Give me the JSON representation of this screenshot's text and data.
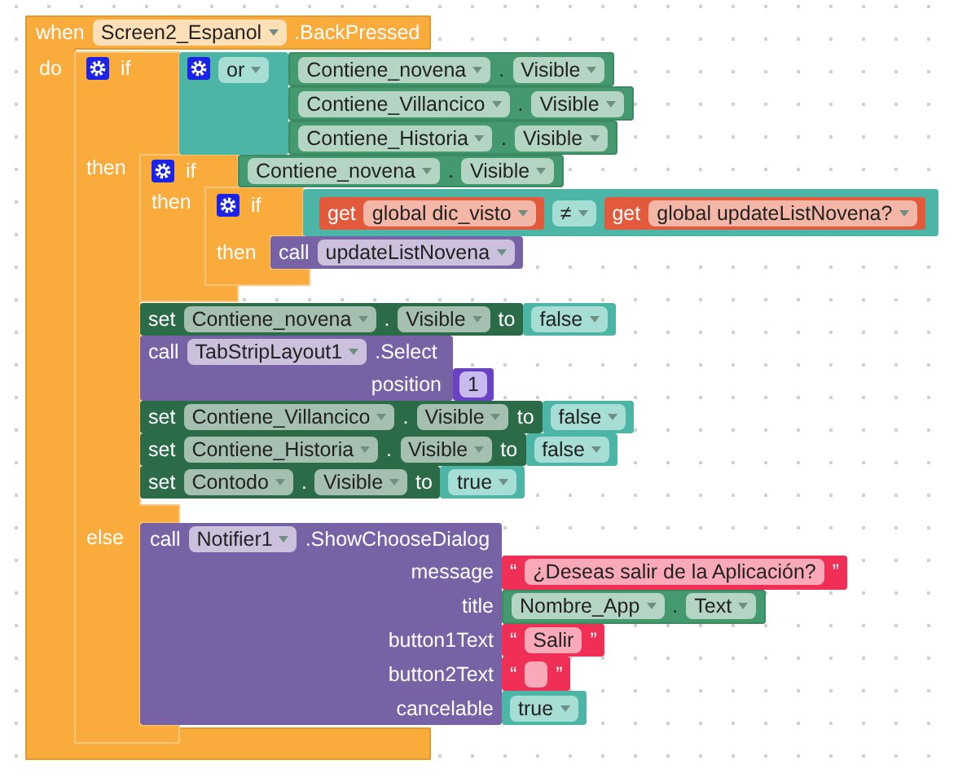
{
  "event": {
    "keyword": "when",
    "component": "Screen2_Espanol",
    "event": ".BackPressed",
    "do_label": "do"
  },
  "if_else": {
    "if_label": "if",
    "then_label": "then",
    "else_label": "else",
    "condition": {
      "operator": "or",
      "operands": [
        {
          "component": "Contiene_novena",
          "dot": ".",
          "property": "Visible"
        },
        {
          "component": "Contiene_Villancico",
          "dot": ".",
          "property": "Visible"
        },
        {
          "component": "Contiene_Historia",
          "dot": ".",
          "property": "Visible"
        }
      ]
    }
  },
  "then_if": {
    "if_label": "if",
    "then_label": "then",
    "condition": {
      "component": "Contiene_novena",
      "dot": ".",
      "property": "Visible"
    },
    "inner_if": {
      "if_label": "if",
      "then_label": "then",
      "compare": {
        "left": {
          "keyword": "get",
          "variable": "global dic_visto"
        },
        "operator": "≠",
        "right": {
          "keyword": "get",
          "variable": "global updateListNovena?"
        }
      },
      "call": {
        "keyword": "call",
        "procedure": "updateListNovena"
      }
    }
  },
  "then_statements": [
    {
      "kind": "set",
      "keyword": "set",
      "component": "Contiene_novena",
      "dot": ".",
      "property": "Visible",
      "to": "to",
      "value": "false"
    },
    {
      "kind": "call",
      "keyword": "call",
      "component": "TabStripLayout1",
      "method": ".Select",
      "argument_label": "position",
      "argument": "1"
    },
    {
      "kind": "set",
      "keyword": "set",
      "component": "Contiene_Villancico",
      "dot": ".",
      "property": "Visible",
      "to": "to",
      "value": "false"
    },
    {
      "kind": "set",
      "keyword": "set",
      "component": "Contiene_Historia",
      "dot": ".",
      "property": "Visible",
      "to": "to",
      "value": "false"
    },
    {
      "kind": "set",
      "keyword": "set",
      "component": "Contodo",
      "dot": ".",
      "property": "Visible",
      "to": "to",
      "value": "true"
    }
  ],
  "else_call": {
    "keyword": "call",
    "component": "Notifier1",
    "method": ".ShowChooseDialog",
    "arguments": [
      {
        "label": "message",
        "kind": "text",
        "open_quote": "“",
        "text": "¿Deseas salir de la Aplicación?",
        "close_quote": "”"
      },
      {
        "label": "title",
        "kind": "getter",
        "component": "Nombre_App",
        "dot": ".",
        "property": "Text"
      },
      {
        "label": "button1Text",
        "kind": "text",
        "open_quote": "“",
        "text": "Salir",
        "close_quote": "”"
      },
      {
        "label": "button2Text",
        "kind": "text",
        "open_quote": "“",
        "close_quote": "”"
      },
      {
        "label": "cancelable",
        "kind": "boolean",
        "value": "true"
      }
    ]
  }
}
